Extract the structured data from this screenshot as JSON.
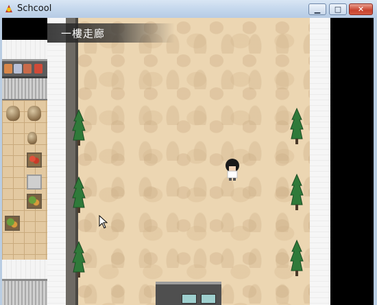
{
  "window": {
    "title": "Schcool",
    "minimize_glyph": "▁",
    "maximize_glyph": "□",
    "close_glyph": "✕",
    "icon": "game-app-icon"
  },
  "game": {
    "location_name": "一樓走廊",
    "scene": "school-first-floor-hallway",
    "player_facing": "down"
  },
  "colors": {
    "hall_floor": "#ecd6b2",
    "wall_white": "#f6f6f6",
    "banner_bg": "#323232",
    "plant_green": "#2f7a3a"
  }
}
